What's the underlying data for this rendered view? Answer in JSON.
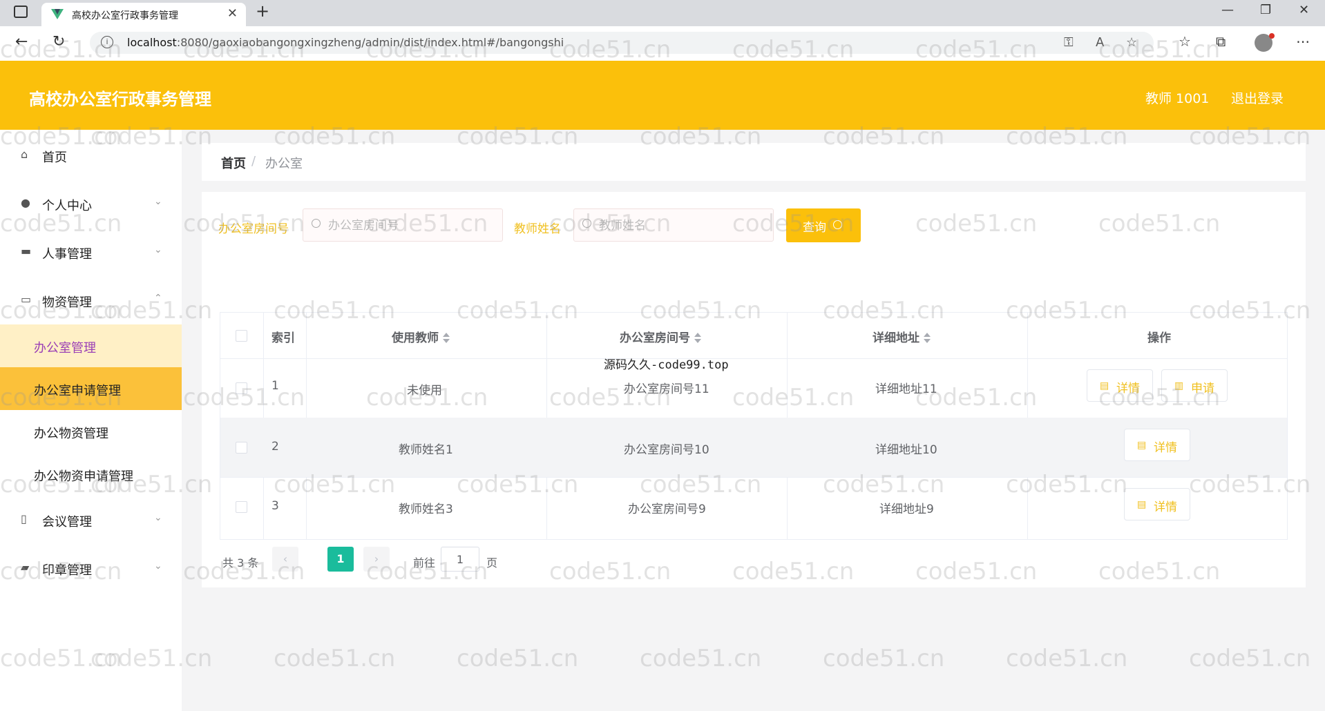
{
  "browser": {
    "tab_title": "高校办公室行政事务管理",
    "url_host": "localhost",
    "url_rest": ":8080/gaoxiaobangongxingzheng/admin/dist/index.html#/bangongshi"
  },
  "header": {
    "title": "高校办公室行政事务管理",
    "user": "教师 1001",
    "logout": "退出登录",
    "color": "#fbc00b"
  },
  "sidebar": {
    "items": [
      {
        "label": "首页",
        "icon": "home-icon"
      },
      {
        "label": "个人中心",
        "icon": "user-icon"
      },
      {
        "label": "人事管理",
        "icon": "briefcase-icon"
      },
      {
        "label": "物资管理",
        "icon": "inventory-icon"
      },
      {
        "label": "会议管理",
        "icon": "microphone-icon"
      },
      {
        "label": "印章管理",
        "icon": "stamp-icon"
      }
    ],
    "sub_items": [
      {
        "label": "办公室管理"
      },
      {
        "label": "办公室申请管理"
      },
      {
        "label": "办公物资管理"
      },
      {
        "label": "办公物资申请管理"
      }
    ]
  },
  "breadcrumb": {
    "home": "首页",
    "separator": "/",
    "current": "办公室"
  },
  "search": {
    "room_label": "办公室房间号",
    "room_placeholder": "办公室房间号",
    "teacher_label": "教师姓名",
    "teacher_placeholder": "教师姓名",
    "query_label": "查询"
  },
  "table": {
    "headers": {
      "index": "索引",
      "teacher": "使用教师",
      "room": "办公室房间号",
      "address": "详细地址",
      "ops": "操作"
    },
    "rows": [
      {
        "index": "1",
        "teacher": "未使用",
        "room": "办公室房间号11",
        "address": "详细地址11",
        "detail": "详情",
        "apply": "申请"
      },
      {
        "index": "2",
        "teacher": "教师姓名1",
        "room": "办公室房间号10",
        "address": "详细地址10",
        "detail": "详情"
      },
      {
        "index": "3",
        "teacher": "教师姓名3",
        "room": "办公室房间号9",
        "address": "详细地址9",
        "detail": "详情"
      }
    ]
  },
  "overlay_text": "源码久久-code99.top",
  "pagination": {
    "total": "共 3 条",
    "prev": "‹",
    "current": "1",
    "next": "›",
    "goto": "前往",
    "goto_value": "1",
    "page_suffix": "页"
  },
  "watermark": "code51.cn"
}
